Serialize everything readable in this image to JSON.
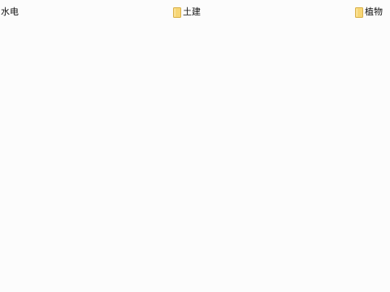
{
  "items": [
    {
      "label": "水电",
      "has_icon": false
    },
    {
      "label": "土建",
      "has_icon": true,
      "icon": "folder-icon"
    },
    {
      "label": "植物",
      "has_icon": true,
      "icon": "folder-icon"
    }
  ],
  "colors": {
    "background": "#fcfcfc",
    "folder_fill": "#f7d675",
    "folder_edge": "#d9b04a"
  }
}
